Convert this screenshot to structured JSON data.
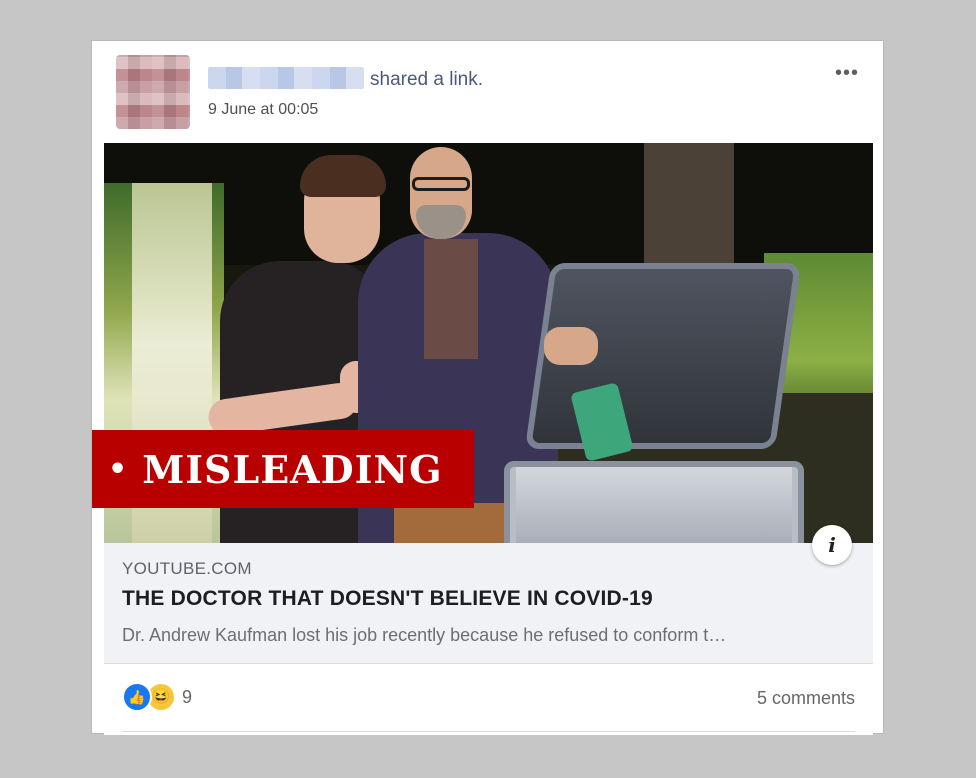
{
  "post": {
    "author_name": "",
    "action_text": "shared a link.",
    "timestamp": "9 June at 00:05",
    "more_icon": "•••"
  },
  "media": {
    "label_dot": "•",
    "label_text": "MISLEADING",
    "label_color": "#b80000",
    "info_icon": "i"
  },
  "link_preview": {
    "domain": "YOUTUBE.COM",
    "headline": "THE DOCTOR THAT DOESN'T BELIEVE IN COVID-19",
    "description": "Dr. Andrew Kaufman lost his job recently because he refused to conform t…"
  },
  "footer": {
    "reaction_count": "9",
    "comments_text": "5 comments"
  }
}
